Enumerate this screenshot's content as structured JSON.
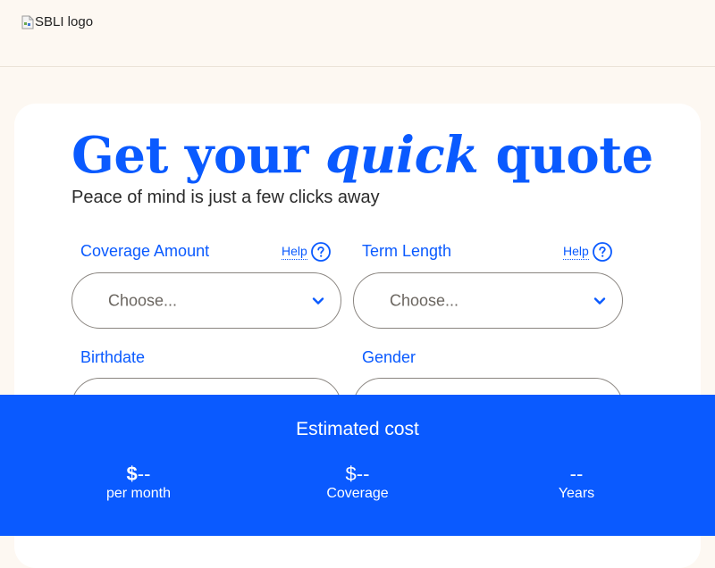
{
  "header": {
    "logo_alt": "SBLI logo"
  },
  "quote": {
    "title_part1": "Get your",
    "title_emphasis": "quick",
    "title_part2": "quote",
    "subtitle": "Peace of mind is just a few clicks away"
  },
  "fields": {
    "coverage": {
      "label": "Coverage Amount",
      "help_label": "Help",
      "value": "Choose..."
    },
    "term": {
      "label": "Term Length",
      "help_label": "Help",
      "value": "Choose..."
    },
    "birthdate": {
      "label": "Birthdate"
    },
    "gender": {
      "label": "Gender"
    }
  },
  "estimate": {
    "title": "Estimated cost",
    "monthly": {
      "currency": "$",
      "value": "--",
      "label": "per month"
    },
    "coverage": {
      "currency": "$",
      "value": "--",
      "label": "Coverage"
    },
    "years": {
      "value": "--",
      "label": "Years"
    }
  },
  "colors": {
    "brand_blue": "#0a5aff",
    "background": "#fdf8f2",
    "card": "#ffffff"
  }
}
